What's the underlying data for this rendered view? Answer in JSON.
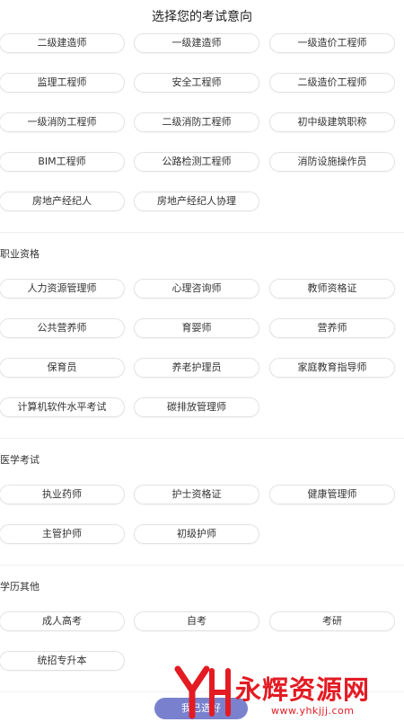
{
  "header": {
    "title": "选择您的考试意向"
  },
  "sections": [
    {
      "title": "",
      "items": [
        "二级建造师",
        "一级建造师",
        "一级造价工程师",
        "监理工程师",
        "安全工程师",
        "二级造价工程师",
        "一级消防工程师",
        "二级消防工程师",
        "初中级建筑职称",
        "BIM工程师",
        "公路检测工程师",
        "消防设施操作员",
        "房地产经纪人",
        "房地产经纪人协理"
      ]
    },
    {
      "title": "职业资格",
      "items": [
        "人力资源管理师",
        "心理咨询师",
        "教师资格证",
        "公共营养师",
        "育婴师",
        "营养师",
        "保育员",
        "养老护理员",
        "家庭教育指导师",
        "计算机软件水平考试",
        "碳排放管理师"
      ]
    },
    {
      "title": "医学考试",
      "items": [
        "执业药师",
        "护士资格证",
        "健康管理师",
        "主管护师",
        "初级护师"
      ]
    },
    {
      "title": "学历其他",
      "items": [
        "成人高考",
        "自考",
        "考研",
        "统招专升本"
      ]
    }
  ],
  "footer": {
    "submit_label": "我已选好"
  },
  "watermark": {
    "brand": "永辉资源网",
    "url": "www.yhkjjj.com"
  },
  "colors": {
    "accent": "#6b74c9",
    "watermark": "#e31b23",
    "border": "#e2e2e2"
  }
}
